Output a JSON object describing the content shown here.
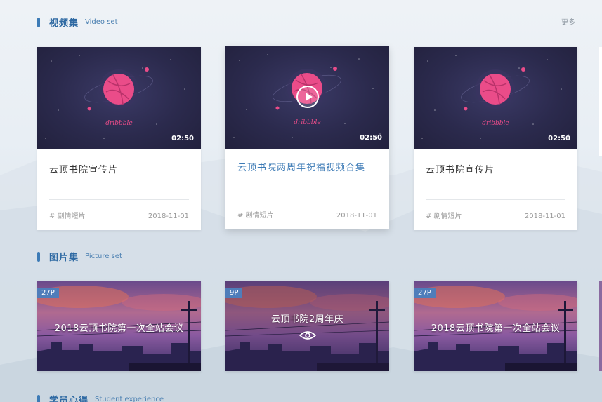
{
  "sections": {
    "video": {
      "title_zh": "视频集",
      "title_en": "Video set",
      "more": "更多"
    },
    "picture": {
      "title_zh": "图片集",
      "title_en": "Picture set"
    },
    "student": {
      "title_zh": "学员心得",
      "title_en": "Student experience"
    }
  },
  "videos": [
    {
      "title": "云顶书院宣传片",
      "duration": "02:50",
      "tag": "# 剧情短片",
      "date": "2018-11-01",
      "brand": "dribbble"
    },
    {
      "title": "云顶书院两周年祝福视频合集",
      "duration": "02:50",
      "tag": "# 剧情短片",
      "date": "2018-11-01",
      "brand": "dribbble"
    },
    {
      "title": "云顶书院宣传片",
      "duration": "02:50",
      "tag": "# 剧情短片",
      "date": "2018-11-01",
      "brand": "dribbble"
    }
  ],
  "pictures": [
    {
      "count": "27P",
      "title": "2018云顶书院第一次全站会议"
    },
    {
      "count": "9P",
      "title": "云顶书院2周年庆"
    },
    {
      "count": "27P",
      "title": "2018云顶书院第一次全站会议"
    }
  ],
  "colors": {
    "accent": "#3d7bb6",
    "badge": "#4f7dba",
    "dribbble_pink": "#ea4c89"
  },
  "icons": {
    "play": "play-icon",
    "view": "eye-icon"
  }
}
